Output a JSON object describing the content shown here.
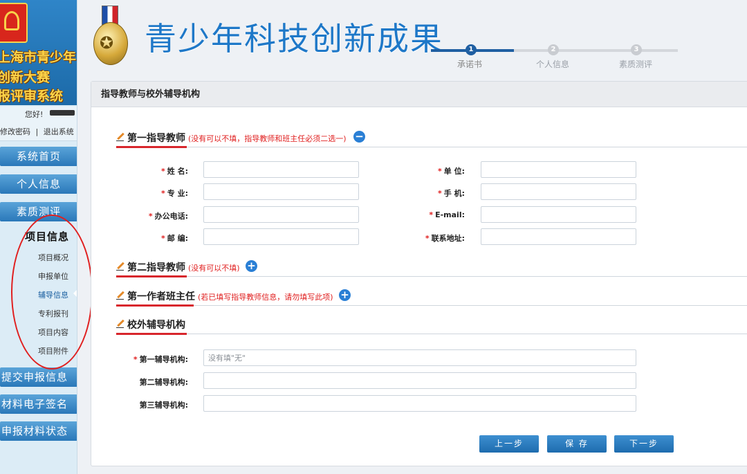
{
  "sidebar": {
    "logo_lines": [
      "上海市青少年",
      "创新大赛",
      "报评审系统"
    ],
    "greeting": "您好!",
    "change_password": "修改密码",
    "separator": "|",
    "logout": "退出系统",
    "nav": {
      "home": "系统首页",
      "personal": "个人信息",
      "quality": "素质测评",
      "project": "项目信息",
      "submit": "提交申报信息",
      "esign": "材料电子签名",
      "status": "申报材料状态"
    },
    "subnav": [
      "项目概况",
      "申报单位",
      "辅导信息",
      "专利报刊",
      "项目内容",
      "项目附件"
    ],
    "current_subnav": "辅导信息"
  },
  "header": {
    "title": "青少年科技创新成果",
    "steps": [
      {
        "num": "1",
        "label": "承诺书",
        "done": true
      },
      {
        "num": "2",
        "label": "个人信息",
        "done": false
      },
      {
        "num": "3",
        "label": "素质测评",
        "done": false
      }
    ]
  },
  "panel": {
    "title": "指导教师与校外辅导机构",
    "sections": {
      "teacher1": {
        "title": "第一指导教师",
        "note": "(没有可以不填，指导教师和班主任必须二选一)",
        "toggle": "−"
      },
      "teacher2": {
        "title": "第二指导教师",
        "note": "(没有可以不填)",
        "toggle": "+"
      },
      "homeroom": {
        "title": "第一作者班主任",
        "note": "(若已填写指导教师信息，请勿填写此项)",
        "toggle": "+"
      },
      "institution": {
        "title": "校外辅导机构"
      }
    },
    "teacher_fields": {
      "name": "姓 名:",
      "major": "专 业:",
      "office_phone": "办公电话:",
      "postcode": "邮 编:",
      "unit": "单 位:",
      "mobile": "手 机:",
      "email": "E-mail:",
      "address": "联系地址:"
    },
    "required_mark": "*",
    "institution_fields": {
      "first": {
        "label": "第一辅导机构:",
        "placeholder": "没有填\"无\""
      },
      "second": {
        "label": "第二辅导机构:"
      },
      "third": {
        "label": "第三辅导机构:"
      }
    },
    "buttons": {
      "prev": "上一步",
      "save": "保 存",
      "next": "下一步"
    }
  }
}
